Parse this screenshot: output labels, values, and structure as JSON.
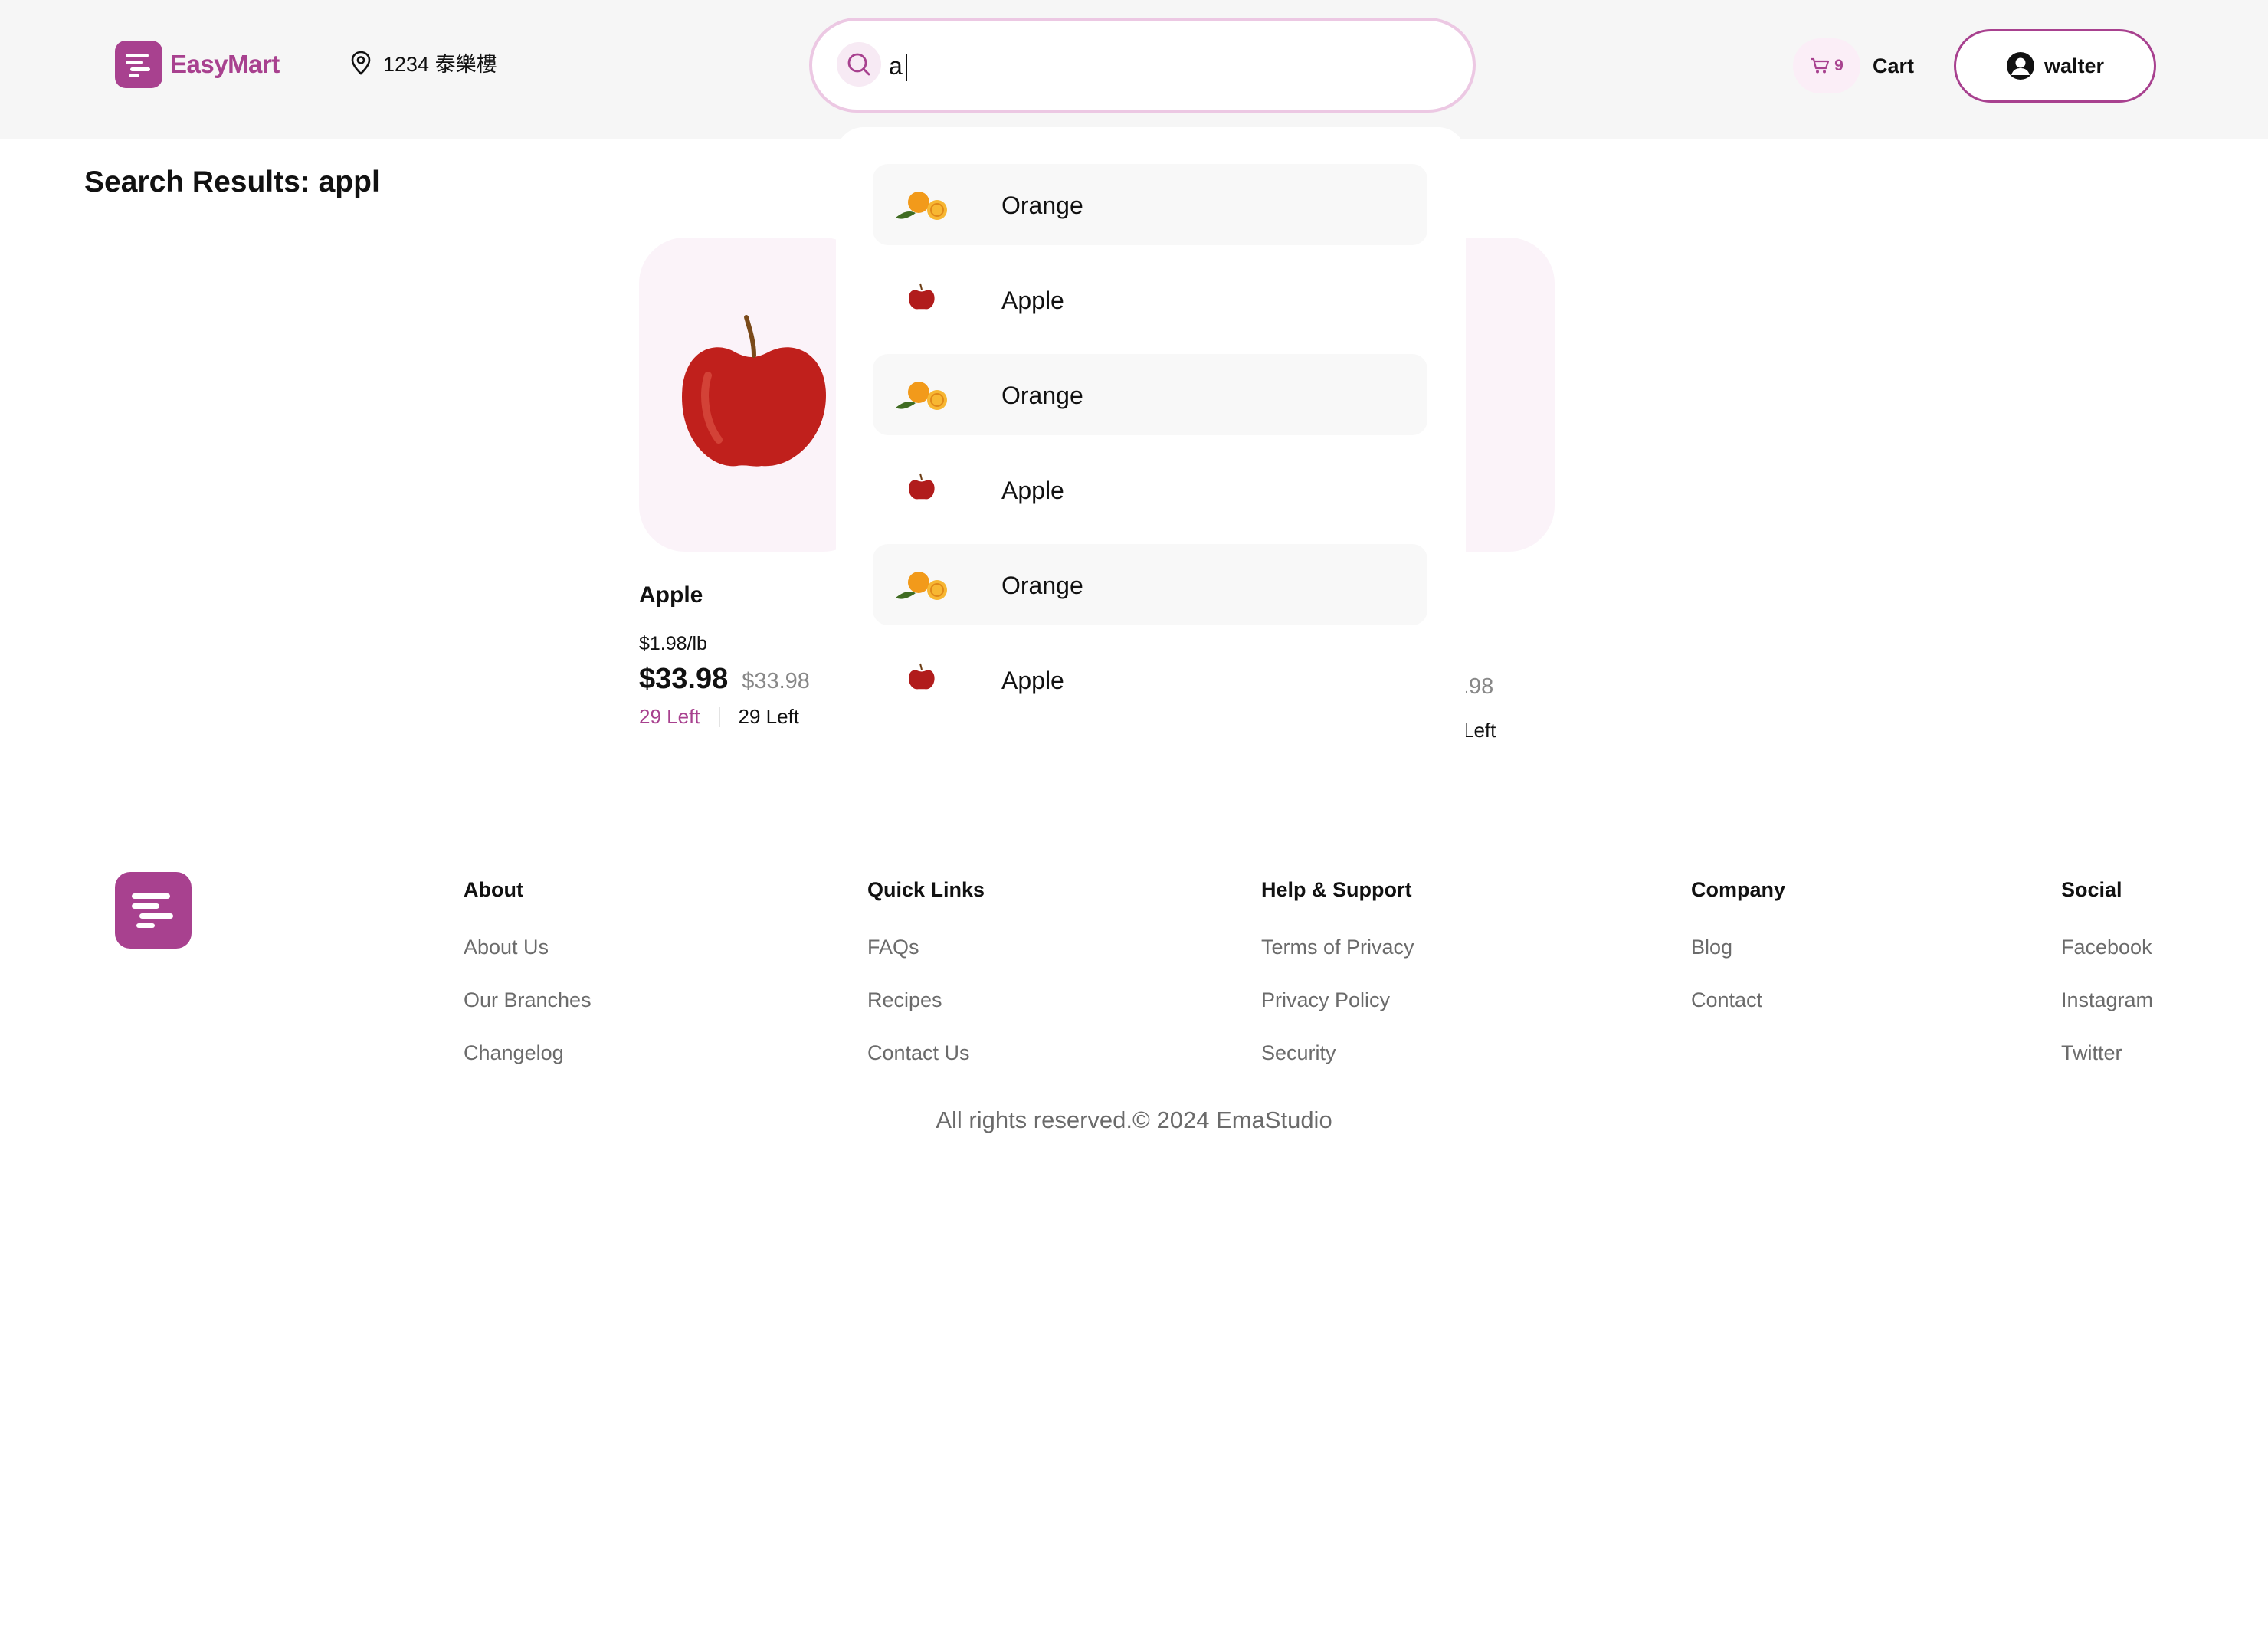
{
  "header": {
    "logo_text": "EasyMart",
    "location": "1234 泰樂樓",
    "search_value": "a",
    "cart_count": "9",
    "cart_label": "Cart",
    "user_name": "walter"
  },
  "results": {
    "title": "Search Results: appl",
    "cards": [
      {
        "name": "Apple",
        "unit_price": "$1.98/lb",
        "price": "$33.98",
        "old_price": "$33.98",
        "stock_left": "29 Left",
        "stock_right": "29 Left"
      },
      {
        "name": "",
        "unit_price": "",
        "price": "",
        "old_price": ".98",
        "stock_left": "",
        "stock_right": "Left"
      }
    ]
  },
  "dropdown": {
    "items": [
      {
        "label": "Orange",
        "icon": "orange-icon"
      },
      {
        "label": "Apple",
        "icon": "apple-icon"
      },
      {
        "label": "Orange",
        "icon": "orange-icon"
      },
      {
        "label": "Apple",
        "icon": "apple-icon"
      },
      {
        "label": "Orange",
        "icon": "orange-icon"
      },
      {
        "label": "Apple",
        "icon": "apple-icon"
      }
    ]
  },
  "footer": {
    "columns": [
      {
        "title": "About",
        "links": [
          "About Us",
          "Our Branches",
          "Changelog"
        ]
      },
      {
        "title": "Quick Links",
        "links": [
          "FAQs",
          "Recipes",
          "Contact Us"
        ]
      },
      {
        "title": "Help & Support",
        "links": [
          "Terms of Privacy",
          "Privacy Policy",
          "Security"
        ]
      },
      {
        "title": "Company",
        "links": [
          "Blog",
          "Contact"
        ]
      },
      {
        "title": "Social",
        "links": [
          "Facebook",
          "Instagram",
          "Twitter"
        ]
      }
    ],
    "copyright": "All rights reserved.© 2024 EmaStudio"
  },
  "colors": {
    "brand": "#a8418f",
    "search_border": "#ecc8e3",
    "card_bg": "#fbf3f9",
    "header_bg": "#f6f6f6"
  }
}
